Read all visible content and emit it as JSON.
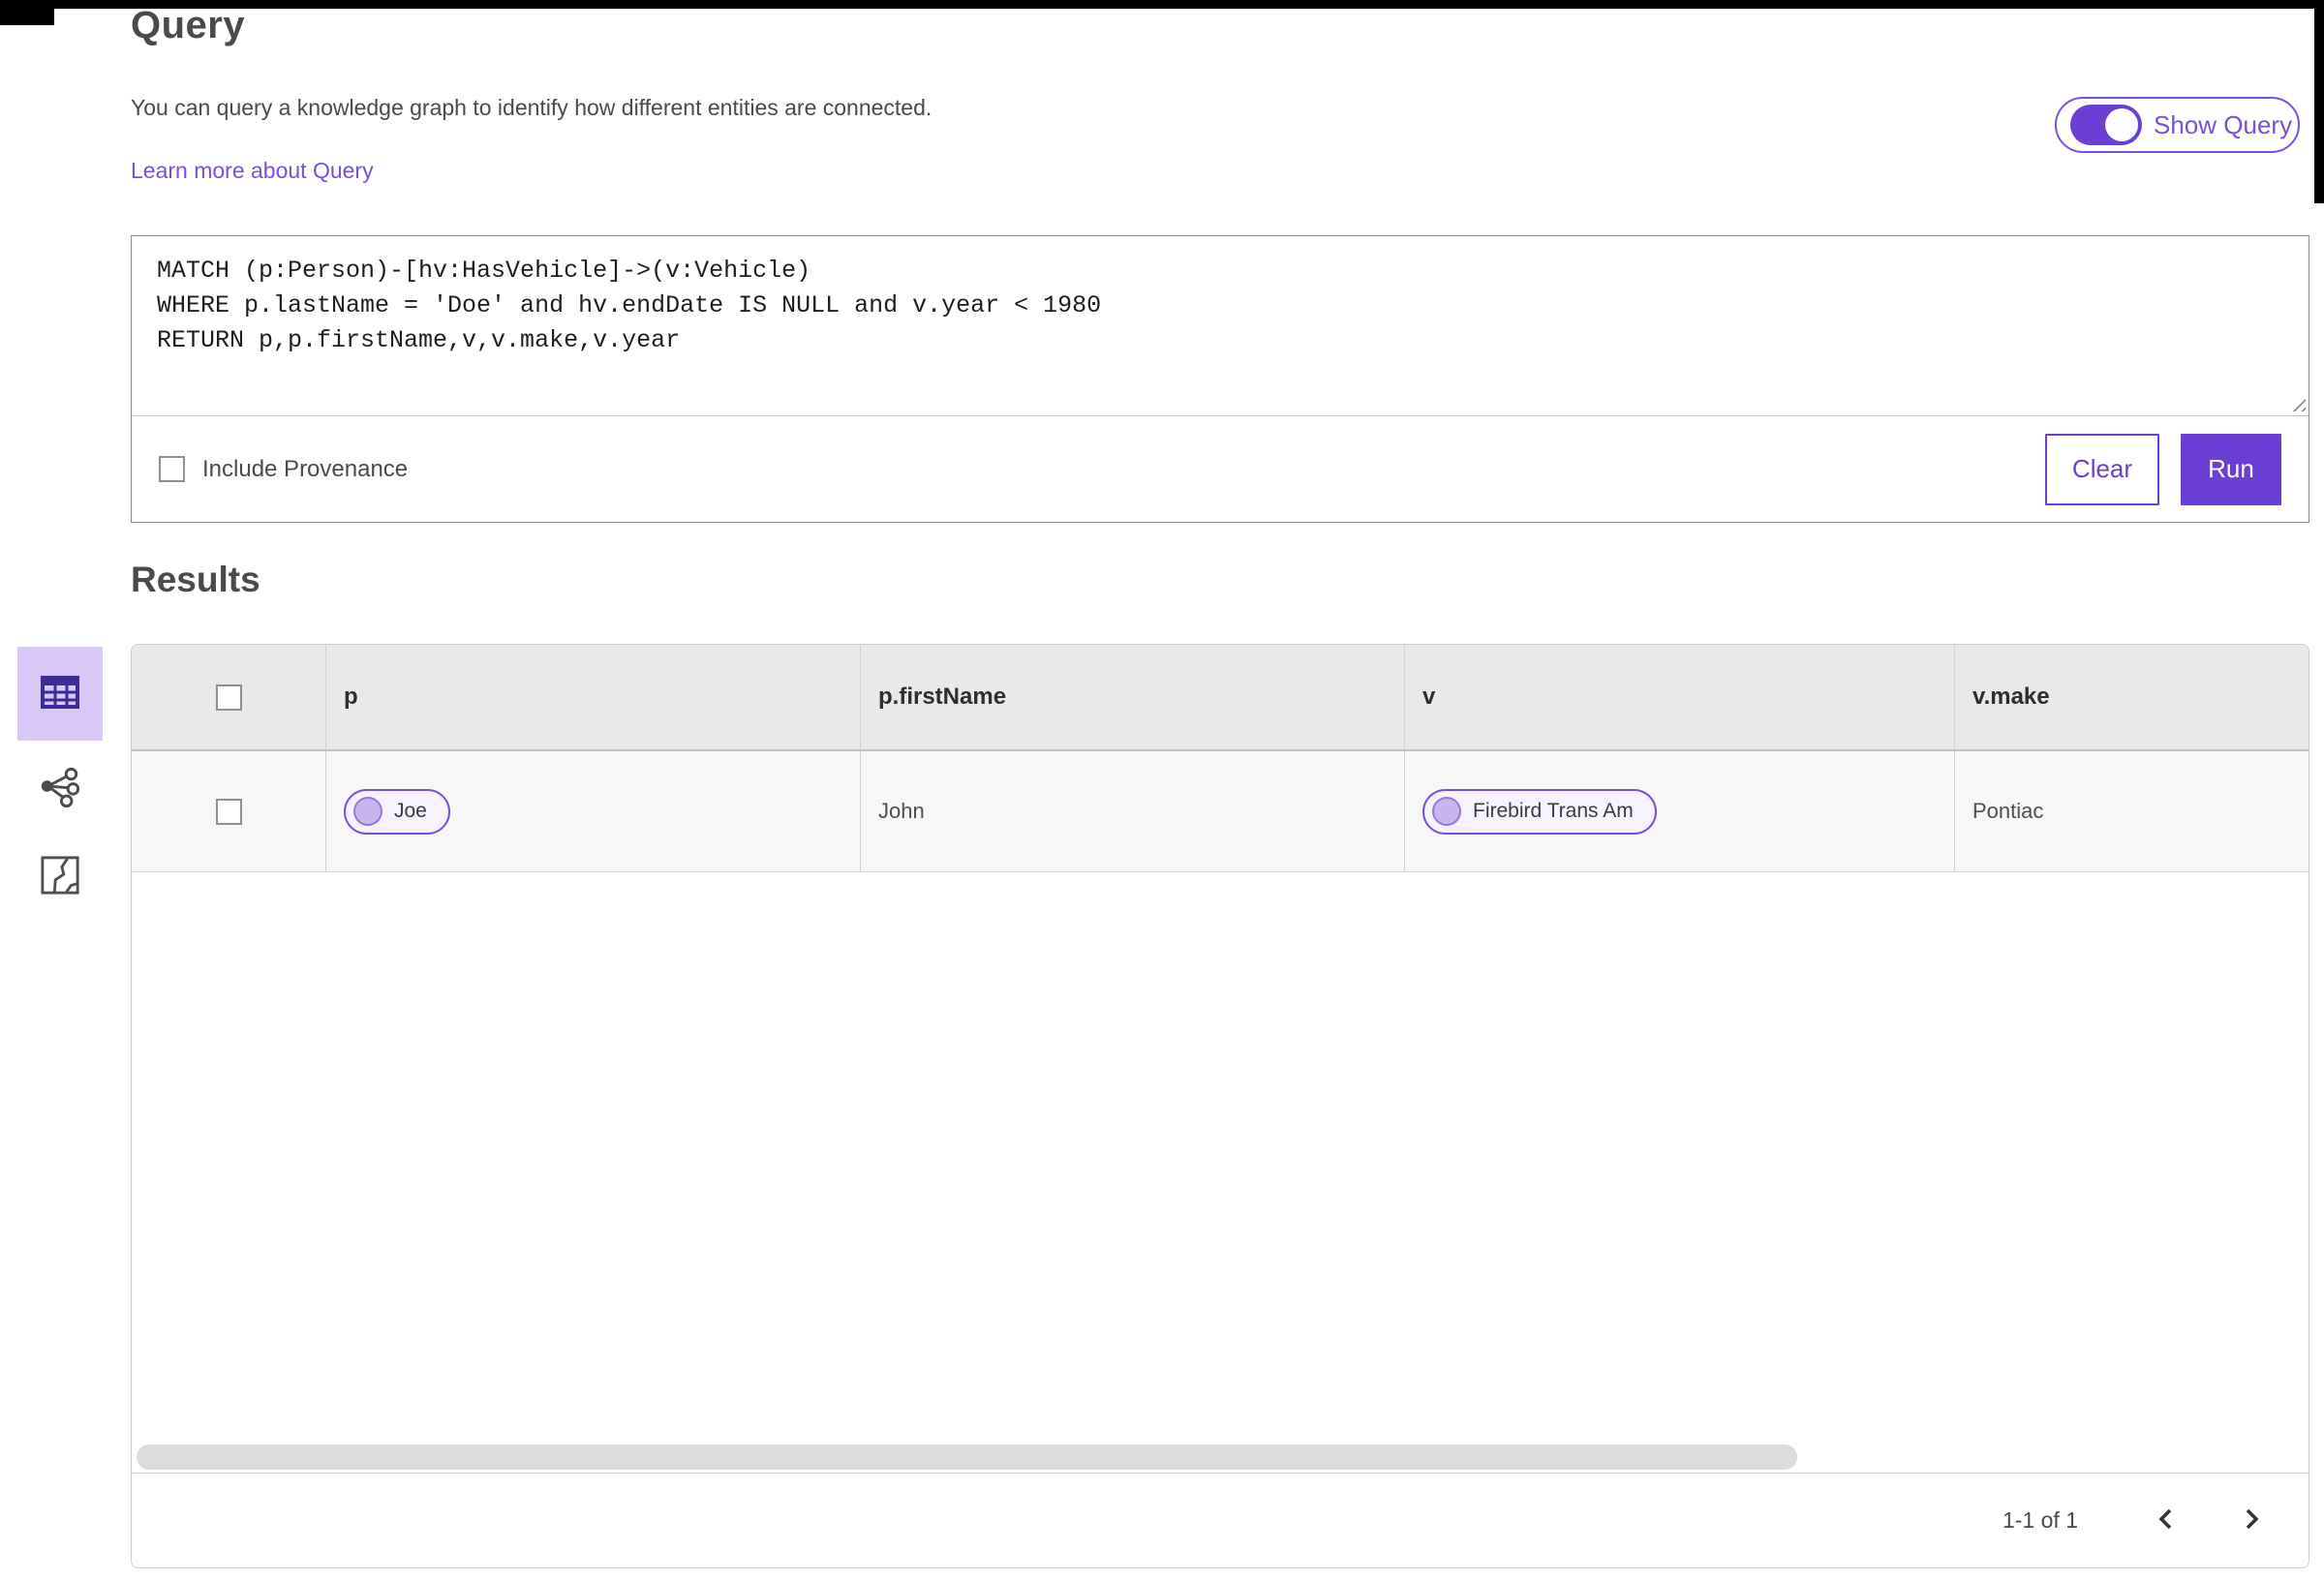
{
  "colors": {
    "accent": "#6B3FD3",
    "accent_outline": "#7A4FD9",
    "accent_light_bg": "#D9C8F6",
    "link": "#7A4FD9",
    "table_header_bg": "#EAE9E9",
    "row_bg": "#F7F7F7"
  },
  "header": {
    "title": "Query",
    "description": "You can query a knowledge graph to identify how different entities are connected.",
    "learn_more_label": "Learn more about Query",
    "show_query": {
      "label": "Show Query",
      "state": "on"
    }
  },
  "query_editor": {
    "text": "MATCH (p:Person)-[hv:HasVehicle]->(v:Vehicle)\nWHERE p.lastName = 'Doe' and hv.endDate IS NULL and v.year < 1980\nRETURN p,p.firstName,v,v.make,v.year",
    "include_provenance": {
      "label": "Include Provenance",
      "checked": false
    },
    "buttons": {
      "clear": "Clear",
      "run": "Run"
    }
  },
  "results": {
    "title": "Results",
    "views": [
      {
        "name": "table-view",
        "icon": "table-icon",
        "selected": true
      },
      {
        "name": "link-chart-view",
        "icon": "link-chart-icon",
        "selected": false
      },
      {
        "name": "map-view",
        "icon": "map-icon",
        "selected": false
      }
    ],
    "table": {
      "columns": [
        "p",
        "p.firstName",
        "v",
        "v.make"
      ],
      "rows": [
        {
          "p": "Joe",
          "p_firstName": "John",
          "v": "Firebird Trans Am",
          "v_make": "Pontiac"
        }
      ]
    },
    "pagination": {
      "range_label": "1-1 of 1",
      "prev_icon": "chevron-left-icon",
      "next_icon": "chevron-right-icon"
    }
  }
}
